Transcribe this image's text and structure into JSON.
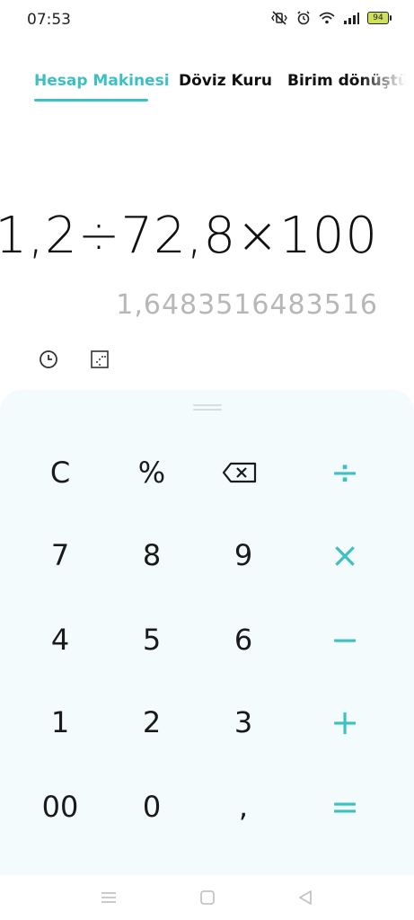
{
  "status_bar": {
    "time": "07:53",
    "battery": "94",
    "icons": [
      "mute-vibrate-icon",
      "alarm-icon",
      "wifi-icon",
      "signal-icon",
      "battery-icon"
    ]
  },
  "tabs": [
    {
      "label": "Hesap Makinesi",
      "active": true
    },
    {
      "label": "Döviz Kuru",
      "active": false
    },
    {
      "label": "Birim dönüştü",
      "active": false
    }
  ],
  "display": {
    "expression": "1,2÷72,8×100",
    "result": "1,6483516483516"
  },
  "tools": [
    "history-icon",
    "scientific-mode-icon"
  ],
  "keypad": {
    "rows": [
      [
        "C",
        "%",
        "⌫",
        "÷"
      ],
      [
        "7",
        "8",
        "9",
        "×"
      ],
      [
        "4",
        "5",
        "6",
        "−"
      ],
      [
        "1",
        "2",
        "3",
        "+"
      ],
      [
        "00",
        "0",
        ",",
        "="
      ]
    ],
    "accent_color": "#3cc0c6"
  },
  "navigation": [
    "menu-icon",
    "home-icon",
    "back-icon"
  ]
}
